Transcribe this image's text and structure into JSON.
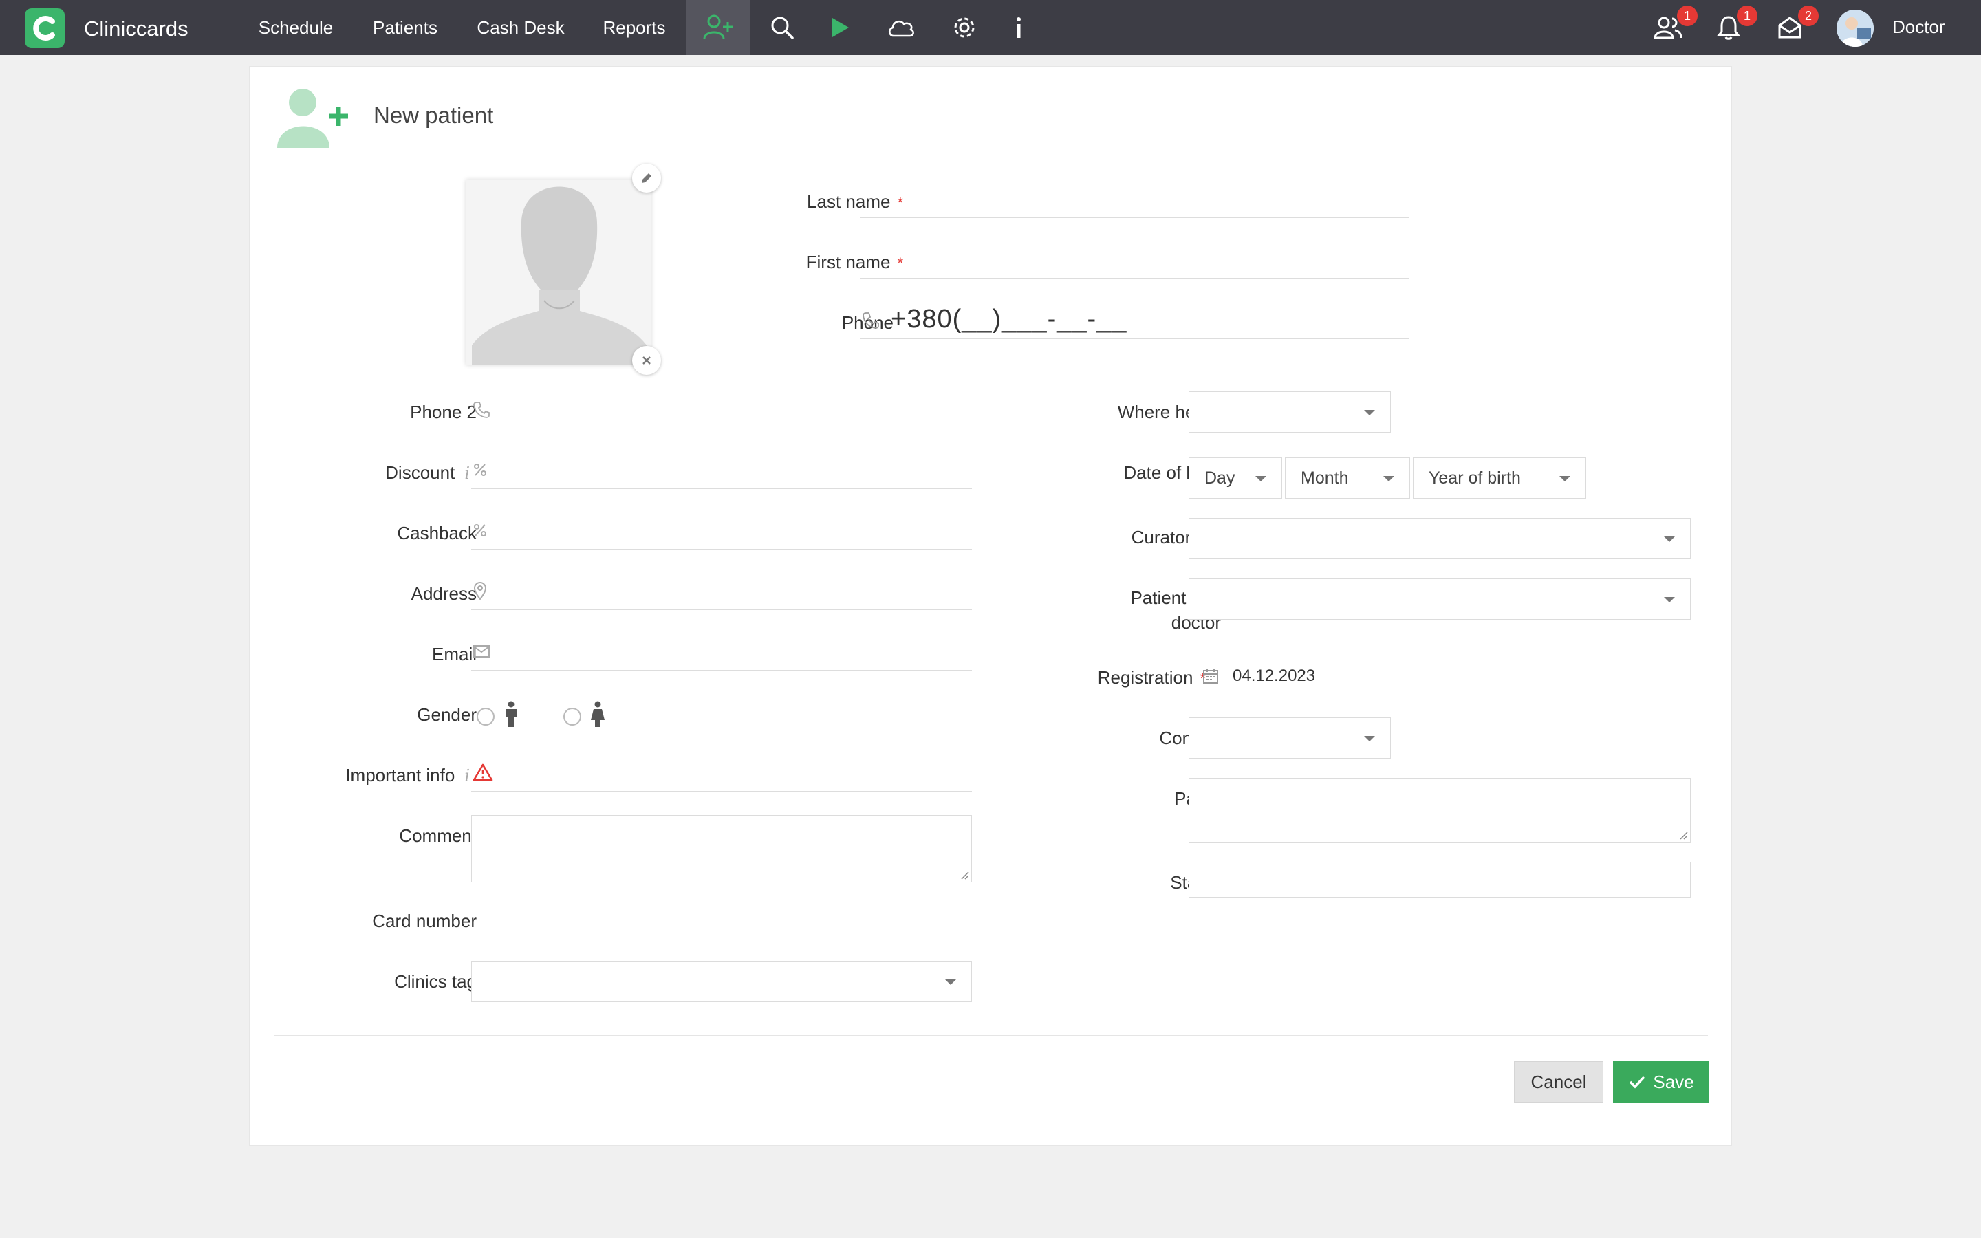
{
  "app": {
    "title": "Cliniccards",
    "logo_letter": "C",
    "brand_color": "#3bb56b"
  },
  "nav": {
    "items": [
      {
        "label": "Schedule"
      },
      {
        "label": "Patients"
      },
      {
        "label": "Cash Desk"
      },
      {
        "label": "Reports"
      }
    ],
    "icons": [
      "add-patient-icon",
      "search-icon",
      "play-icon",
      "cloud-icon",
      "gear-icon",
      "info-icon"
    ]
  },
  "notifications": {
    "patients_badge": "1",
    "bell_badge": "1",
    "mail_badge": "2"
  },
  "user": {
    "name": "Doctor"
  },
  "form": {
    "title": "New patient",
    "fields": {
      "last_name": {
        "label": "Last name",
        "value": ""
      },
      "first_name": {
        "label": "First name",
        "value": ""
      },
      "phone": {
        "label": "Phone",
        "value": "+380(__)___-__-__"
      },
      "phone2": {
        "label": "Phone 2",
        "value": ""
      },
      "discount": {
        "label": "Discount",
        "value": ""
      },
      "cashback": {
        "label": "Cashback",
        "value": ""
      },
      "address": {
        "label": "Address",
        "value": ""
      },
      "email": {
        "label": "Email",
        "value": ""
      },
      "gender": {
        "label": "Gender"
      },
      "important_info": {
        "label": "Important info",
        "value": ""
      },
      "comment": {
        "label": "Comment",
        "value": ""
      },
      "card_number": {
        "label": "Card number",
        "value": ""
      },
      "clinics_tag": {
        "label": "Clinics tag",
        "value": ""
      },
      "where_heard": {
        "label": "Where heard",
        "value": ""
      },
      "date_of_birth": {
        "label": "Date of birth",
        "day": "Day",
        "month": "Month",
        "year": "Year of birth"
      },
      "curator": {
        "label": "Curator",
        "value": ""
      },
      "patient_of_doctor": {
        "label": "Patient of a doctor",
        "value": ""
      },
      "registration": {
        "label": "Registration",
        "value": "04.12.2023"
      },
      "contact": {
        "label": "Contact",
        "value": ""
      },
      "payer": {
        "label": "Payer",
        "value": ""
      },
      "status": {
        "label": "Status",
        "value": ""
      }
    },
    "required_marker": "*",
    "info_marker": "i"
  },
  "actions": {
    "cancel": "Cancel",
    "save": "Save"
  },
  "colors": {
    "topbar": "#3d3d45",
    "save": "#3aaa5c",
    "required": "#e53935",
    "badge": "#e53935"
  }
}
